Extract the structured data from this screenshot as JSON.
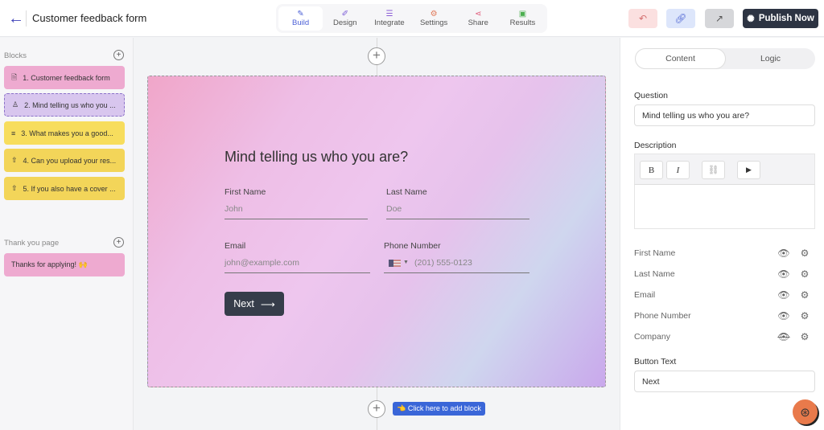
{
  "header": {
    "title": "Customer feedback form",
    "publish_label": "Publish Now",
    "tabs": [
      {
        "label": "Build",
        "icon": "✎",
        "color": "#4b5fd6"
      },
      {
        "label": "Design",
        "icon": "✐",
        "color": "#7b5cd6"
      },
      {
        "label": "Integrate",
        "icon": "☰",
        "color": "#8a5cd6"
      },
      {
        "label": "Settings",
        "icon": "⚙",
        "color": "#e07a5a"
      },
      {
        "label": "Share",
        "icon": "⋖",
        "color": "#e05a7a"
      },
      {
        "label": "Results",
        "icon": "▣",
        "color": "#4caf50"
      }
    ]
  },
  "sidebar": {
    "blocks_label": "Blocks",
    "blocks": [
      {
        "label": "1. Customer feedback form",
        "icon": "🗎"
      },
      {
        "label": "2. Mind telling us who you ...",
        "icon": "♙"
      },
      {
        "label": "3. What makes you a good...",
        "icon": "≡"
      },
      {
        "label": "4. Can you upload your res...",
        "icon": "⇧"
      },
      {
        "label": "5. If you also have a cover ...",
        "icon": "⇧"
      }
    ],
    "thanks_label": "Thank you page",
    "thanks_item": "Thanks for applying! 🙌"
  },
  "form": {
    "question": "Mind telling us who you are?",
    "first_name": {
      "label": "First Name",
      "placeholder": "John"
    },
    "last_name": {
      "label": "Last Name",
      "placeholder": "Doe"
    },
    "email": {
      "label": "Email",
      "placeholder": "john@example.com"
    },
    "phone": {
      "label": "Phone Number",
      "placeholder": "(201) 555-0123"
    },
    "next": "Next",
    "add_block": "👈 Click here to add block"
  },
  "panel": {
    "tabs": [
      "Content",
      "Logic"
    ],
    "question_label": "Question",
    "question_value": "Mind telling us who you are?",
    "description_label": "Description",
    "fields": [
      {
        "name": "First Name",
        "visible": true
      },
      {
        "name": "Last Name",
        "visible": true
      },
      {
        "name": "Email",
        "visible": true
      },
      {
        "name": "Phone Number",
        "visible": true
      },
      {
        "name": "Company",
        "visible": false
      }
    ],
    "button_text_label": "Button Text",
    "button_text_value": "Next"
  }
}
